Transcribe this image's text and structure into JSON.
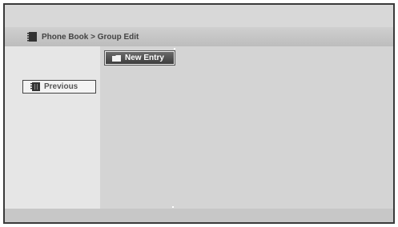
{
  "header": {
    "title": "Phone Book > Group Edit"
  },
  "content": {
    "new_entry_label": "New Entry"
  },
  "sidebar": {
    "previous_label": "Previous"
  },
  "icons": {
    "title": "phone-book-icon",
    "new_entry": "folder-icon",
    "previous": "phone-book-icon"
  }
}
